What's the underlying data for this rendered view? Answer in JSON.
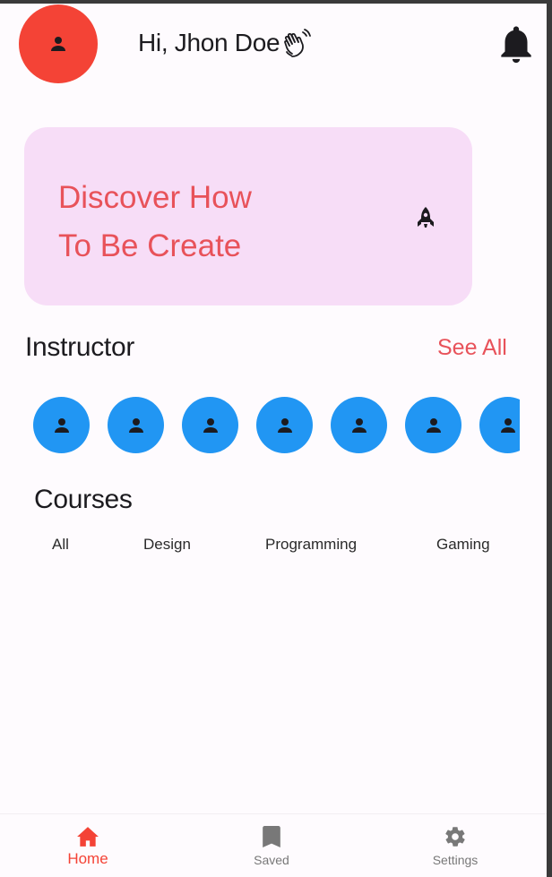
{
  "header": {
    "avatar_icon": "person-icon",
    "greeting": "Hi, Jhon Doe",
    "greeting_emoji": "waving-hand-icon",
    "notification_icon": "bell-icon"
  },
  "banner": {
    "line1": "Discover How",
    "line2": "To Be Create",
    "icon": "rocket-icon",
    "background": "#f7ddf7",
    "text_color": "#e8525a"
  },
  "instructor": {
    "title": "Instructor",
    "see_all": "See All",
    "avatars": [
      "person-icon",
      "person-icon",
      "person-icon",
      "person-icon",
      "person-icon",
      "person-icon",
      "person-icon"
    ],
    "avatar_color": "#2196f3"
  },
  "courses": {
    "title": "Courses",
    "tabs": [
      "All",
      "Design",
      "Programming",
      "Gaming"
    ]
  },
  "bottom_nav": {
    "items": [
      {
        "label": "Home",
        "icon": "home-icon",
        "active": true
      },
      {
        "label": "Saved",
        "icon": "bookmark-icon",
        "active": false
      },
      {
        "label": "Settings",
        "icon": "gear-icon",
        "active": false
      }
    ],
    "active_color": "#f44336",
    "inactive_color": "#787878"
  }
}
